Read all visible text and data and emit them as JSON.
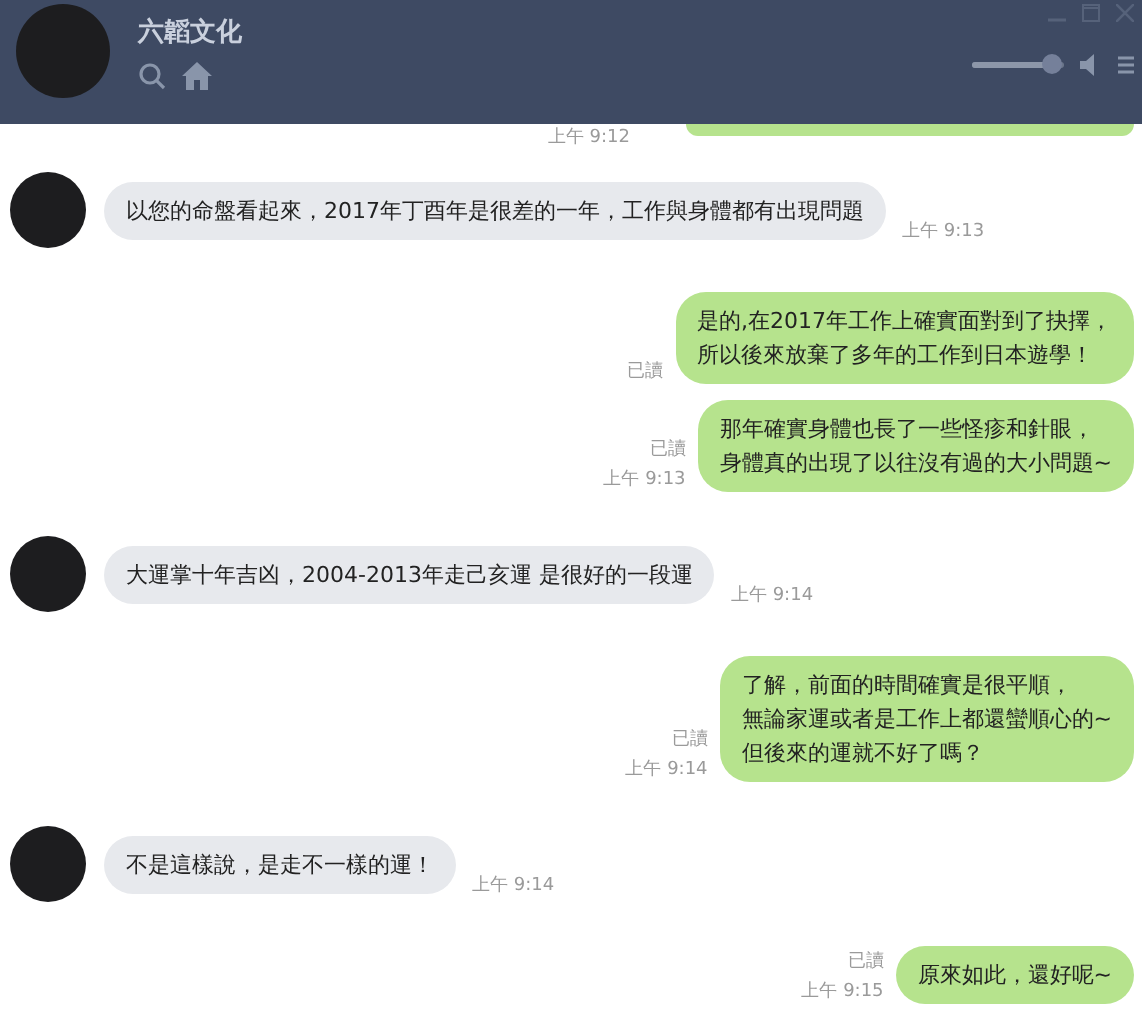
{
  "header": {
    "title": "六韜文化",
    "volume": {
      "level": 0.88
    }
  },
  "previous": {
    "time": "上午 9:12"
  },
  "messages": [
    {
      "kind": "incoming",
      "lines": [
        "以您的命盤看起來，2017年丁酉年是很差的一年，工作與身體都有出現問題"
      ],
      "time": "上午 9:13"
    },
    {
      "kind": "outgoing",
      "lines": [
        "是的,在2017年工作上確實面對到了抉擇，",
        "所以後來放棄了多年的工作到日本遊學！"
      ],
      "read": "已讀"
    },
    {
      "kind": "outgoing",
      "lines": [
        "那年確實身體也長了一些怪疹和針眼，",
        "身體真的出現了以往沒有過的大小問題~"
      ],
      "read": "已讀",
      "time": "上午 9:13"
    },
    {
      "kind": "incoming",
      "lines": [
        "大運掌十年吉凶，2004-2013年走己亥運 是很好的一段運"
      ],
      "time": "上午 9:14"
    },
    {
      "kind": "outgoing",
      "lines": [
        "了解，前面的時間確實是很平順，",
        "無論家運或者是工作上都還蠻順心的~",
        "但後來的運就不好了嗎？"
      ],
      "read": "已讀",
      "time": "上午 9:14"
    },
    {
      "kind": "incoming",
      "lines": [
        "不是這樣說，是走不一樣的運！"
      ],
      "time": "上午 9:14"
    },
    {
      "kind": "outgoing",
      "lines": [
        "原來如此，還好呢~"
      ],
      "read": "已讀",
      "time": "上午 9:15"
    }
  ]
}
